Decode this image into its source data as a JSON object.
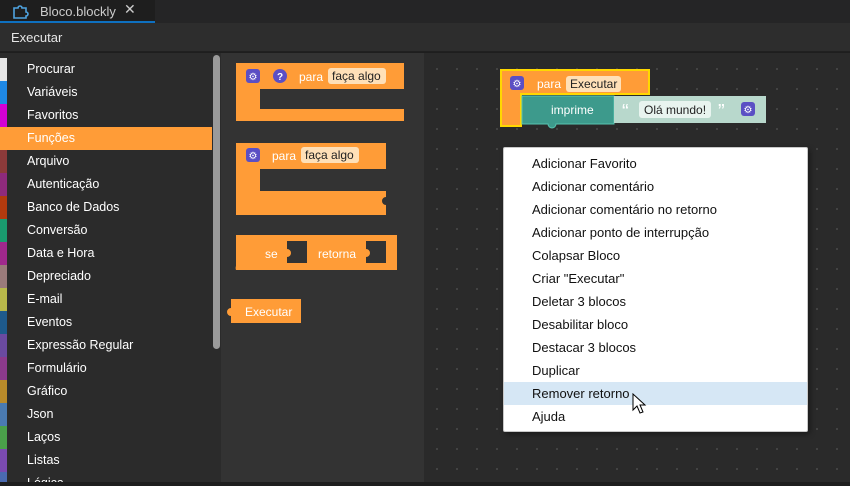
{
  "tab": {
    "title": "Bloco.blockly",
    "close": "✕",
    "icon": "blockly-puzzle-icon"
  },
  "toolbar": {
    "label": "Executar"
  },
  "categories": [
    {
      "label": "Procurar",
      "color": "#e6e6e6",
      "selected": false
    },
    {
      "label": "Variáveis",
      "color": "#1e88e5",
      "selected": false
    },
    {
      "label": "Favoritos",
      "color": "#d400d4",
      "selected": false
    },
    {
      "label": "Funções",
      "color": "#ff9c37",
      "selected": true
    },
    {
      "label": "Arquivo",
      "color": "#8c3a3a",
      "selected": false
    },
    {
      "label": "Autenticação",
      "color": "#8e2a7c",
      "selected": false
    },
    {
      "label": "Banco de Dados",
      "color": "#b23a0e",
      "selected": false
    },
    {
      "label": "Conversão",
      "color": "#1a9a6e",
      "selected": false
    },
    {
      "label": "Data e Hora",
      "color": "#a0288c",
      "selected": false
    },
    {
      "label": "Depreciado",
      "color": "#9a7a7a",
      "selected": false
    },
    {
      "label": "E-mail",
      "color": "#b8b84a",
      "selected": false
    },
    {
      "label": "Eventos",
      "color": "#1e5a8c",
      "selected": false
    },
    {
      "label": "Expressão Regular",
      "color": "#6a4aa0",
      "selected": false
    },
    {
      "label": "Formulário",
      "color": "#8c3a8c",
      "selected": false
    },
    {
      "label": "Gráfico",
      "color": "#b88a2a",
      "selected": false
    },
    {
      "label": "Json",
      "color": "#4a7ab0",
      "selected": false
    },
    {
      "label": "Laços",
      "color": "#4aa04a",
      "selected": false
    },
    {
      "label": "Listas",
      "color": "#7a4ab0",
      "selected": false
    },
    {
      "label": "Lógica",
      "color": "#4a6ab0",
      "selected": false
    }
  ],
  "flyout": {
    "block1": {
      "keyword": "para",
      "field": "faça algo",
      "help": "?"
    },
    "block2": {
      "keyword": "para",
      "field": "faça algo"
    },
    "block3": {
      "keyword": "se",
      "keyword2": "retorna"
    },
    "block4": {
      "label": "Executar"
    }
  },
  "workspace": {
    "func": {
      "keyword": "para",
      "name": "Executar"
    },
    "print": {
      "label": "imprime",
      "quote_open": "“",
      "text": "Olá mundo!",
      "quote_close": "”"
    }
  },
  "context_menu": {
    "items": [
      "Adicionar Favorito",
      "Adicionar comentário",
      "Adicionar comentário no retorno",
      "Adicionar ponto de interrupção",
      "Colapsar Bloco",
      "Criar \"Executar\"",
      "Deletar 3 blocos",
      "Desabilitar bloco",
      "Destacar 3 blocos",
      "Duplicar",
      "Remover retorno",
      "Ajuda"
    ],
    "hover_index": 10
  },
  "colors": {
    "function_block": "#ff9c37",
    "print_block": "#3d9a8c",
    "text_block": "#b8d8cc",
    "gear": "#5b4fc4"
  }
}
